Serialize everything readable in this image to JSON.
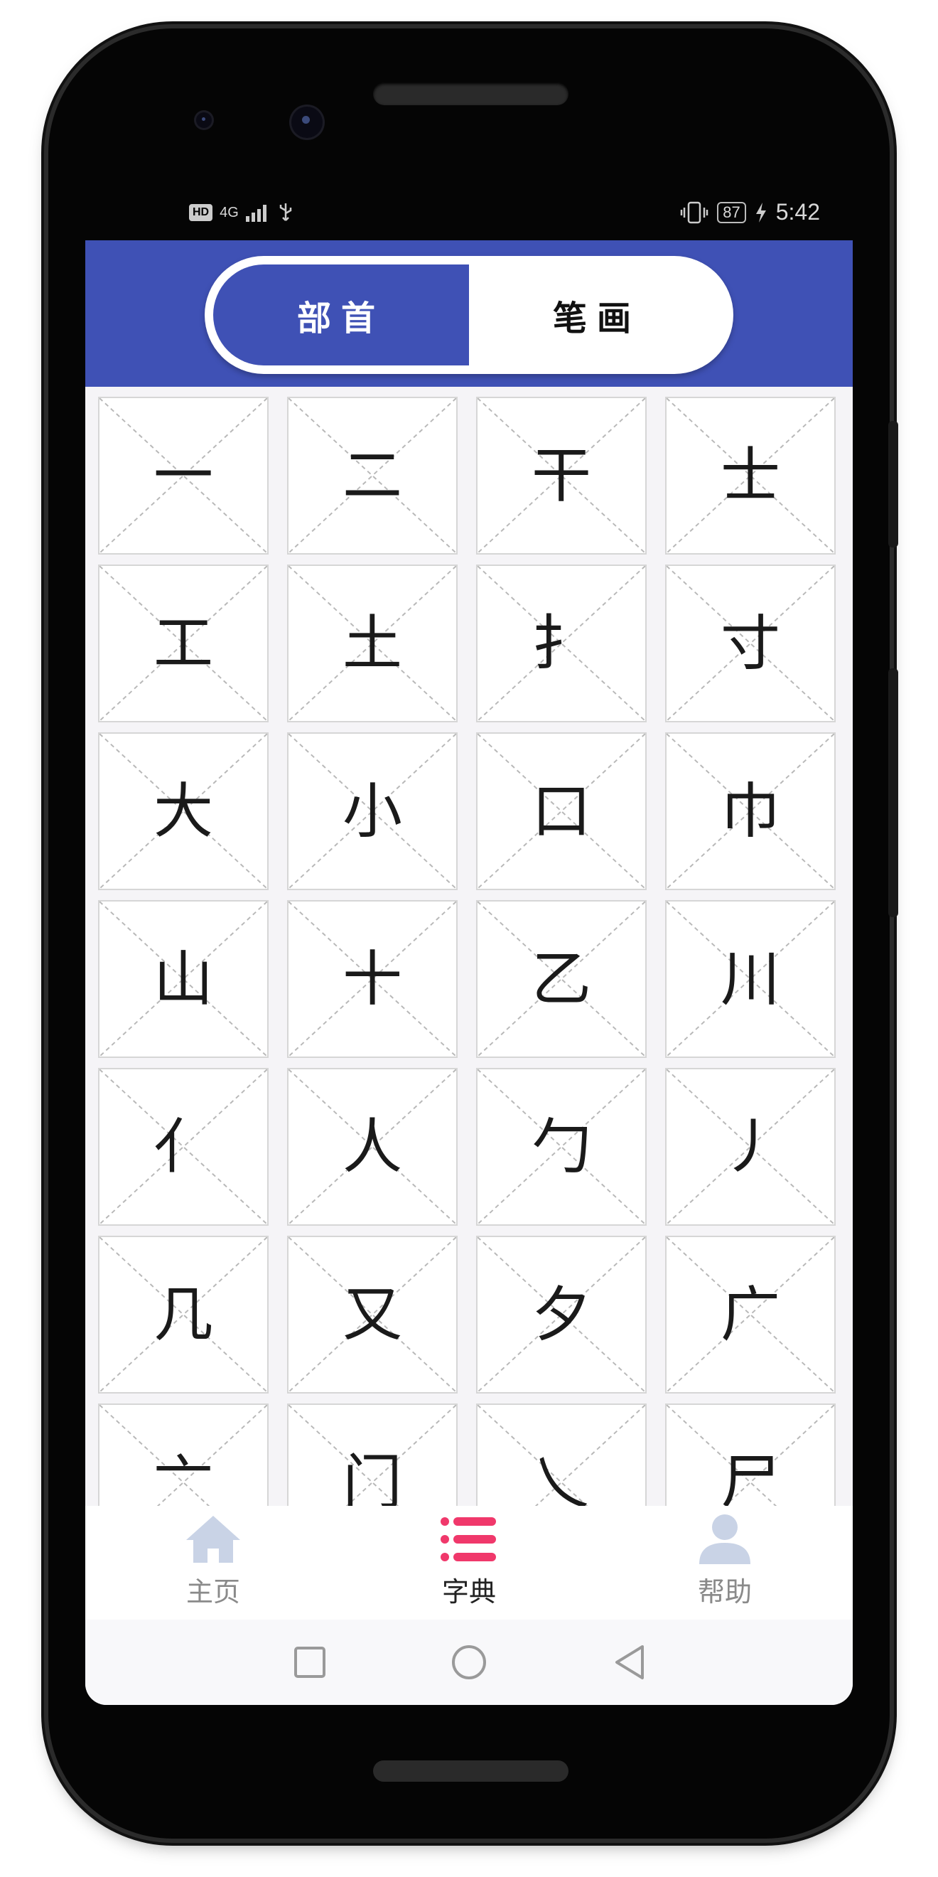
{
  "status_bar": {
    "network": "HD",
    "signal_text": "4G",
    "battery_level": "87",
    "time": "5:42"
  },
  "segmented": {
    "radicals_label": "部首",
    "strokes_label": "笔画",
    "selected": "radicals"
  },
  "radicals": [
    "一",
    "二",
    "干",
    "士",
    "工",
    "土",
    "扌",
    "寸",
    "大",
    "小",
    "口",
    "巾",
    "山",
    "十",
    "乙",
    "川",
    "亻",
    "人",
    "勹",
    "丿",
    "几",
    "又",
    "夕",
    "广",
    "亠",
    "门",
    "乀",
    "尸"
  ],
  "bottom_tabs": [
    {
      "label": "主页",
      "icon": "home-icon",
      "active": false
    },
    {
      "label": "字典",
      "icon": "list-icon",
      "active": true
    },
    {
      "label": "帮助",
      "icon": "person-icon",
      "active": false
    }
  ],
  "colors": {
    "primary": "#3f51b5",
    "accent": "#f0386b",
    "inactive_icon": "#c9d3e6"
  }
}
